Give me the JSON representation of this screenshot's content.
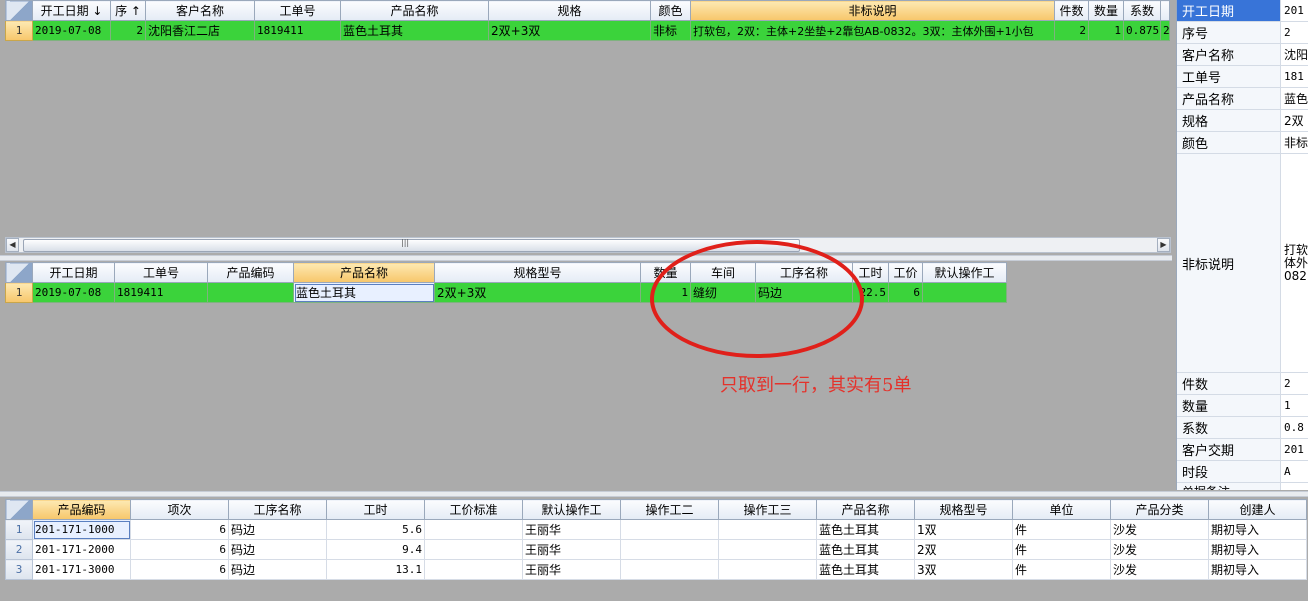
{
  "top_grid": {
    "headers": [
      "开工日期 ↓",
      "序 ↑",
      "客户名称",
      "工单号",
      "产品名称",
      "规格",
      "颜色",
      "非标说明",
      "件数",
      "数量",
      "系数"
    ],
    "row": {
      "num": "1",
      "date": "2019-07-08",
      "seq": "2",
      "customer": "沈阳香江二店",
      "order": "1819411",
      "product": "蓝色土耳其",
      "spec": "2双+3双",
      "color": "非标",
      "desc": "打软包，2双：主体+2坐垫+2靠包AB-0832。3双：主体外围+1小包",
      "pieces": "2",
      "qty": "1",
      "coef": "0.875",
      "extra": "2"
    }
  },
  "mid_grid": {
    "headers": [
      "开工日期",
      "工单号",
      "产品编码",
      "产品名称",
      "规格型号",
      "数量",
      "车间",
      "工序名称",
      "工时",
      "工价",
      "默认操作工"
    ],
    "row": {
      "num": "1",
      "date": "2019-07-08",
      "order": "1819411",
      "code": "",
      "product": "蓝色土耳其",
      "spec": "2双+3双",
      "qty": "1",
      "workshop": "缝纫",
      "process": "码边",
      "hours": "22.5",
      "price": "6",
      "operator": ""
    }
  },
  "bottom_grid": {
    "headers": [
      "产品编码",
      "项次",
      "工序名称",
      "工时",
      "工价标准",
      "默认操作工",
      "操作工二",
      "操作工三",
      "产品名称",
      "规格型号",
      "单位",
      "产品分类",
      "创建人"
    ],
    "rows": [
      {
        "num": "1",
        "code": "201-171-1000",
        "item": "6",
        "process": "码边",
        "hours": "5.6",
        "std": "",
        "operator": "王丽华",
        "op2": "",
        "op3": "",
        "product": "蓝色土耳其",
        "spec": "1双",
        "unit": "件",
        "category": "沙发",
        "creator": "期初导入"
      },
      {
        "num": "2",
        "code": "201-171-2000",
        "item": "6",
        "process": "码边",
        "hours": "9.4",
        "std": "",
        "operator": "王丽华",
        "op2": "",
        "op3": "",
        "product": "蓝色土耳其",
        "spec": "2双",
        "unit": "件",
        "category": "沙发",
        "creator": "期初导入"
      },
      {
        "num": "3",
        "code": "201-171-3000",
        "item": "6",
        "process": "码边",
        "hours": "13.1",
        "std": "",
        "operator": "王丽华",
        "op2": "",
        "op3": "",
        "product": "蓝色土耳其",
        "spec": "3双",
        "unit": "件",
        "category": "沙发",
        "creator": "期初导入"
      }
    ]
  },
  "scrollbar": {
    "left": "◀",
    "right": "▶",
    "grip": "|||"
  },
  "side_panel": {
    "rows": [
      {
        "k": "开工日期",
        "v": "201"
      },
      {
        "k": "序号",
        "v": "2"
      },
      {
        "k": "客户名称",
        "v": "沈阳"
      },
      {
        "k": "工单号",
        "v": "181"
      },
      {
        "k": "产品名称",
        "v": "蓝色"
      },
      {
        "k": "规格",
        "v": "2双"
      },
      {
        "k": "颜色",
        "v": "非标"
      },
      {
        "k": "非标说明",
        "v": "打软 体外 082"
      },
      {
        "k": "件数",
        "v": "2"
      },
      {
        "k": "数量",
        "v": "1"
      },
      {
        "k": "系数",
        "v": "0.8"
      },
      {
        "k": "客户交期",
        "v": "201"
      },
      {
        "k": "时段",
        "v": "A"
      },
      {
        "k": "单据备注",
        "v": ""
      }
    ]
  },
  "annotation": "只取到一行，其实有5单",
  "colors": {
    "row_green": "#3bd33b",
    "header_selected": "#f7c66a",
    "annotation_red": "#e0201a"
  }
}
